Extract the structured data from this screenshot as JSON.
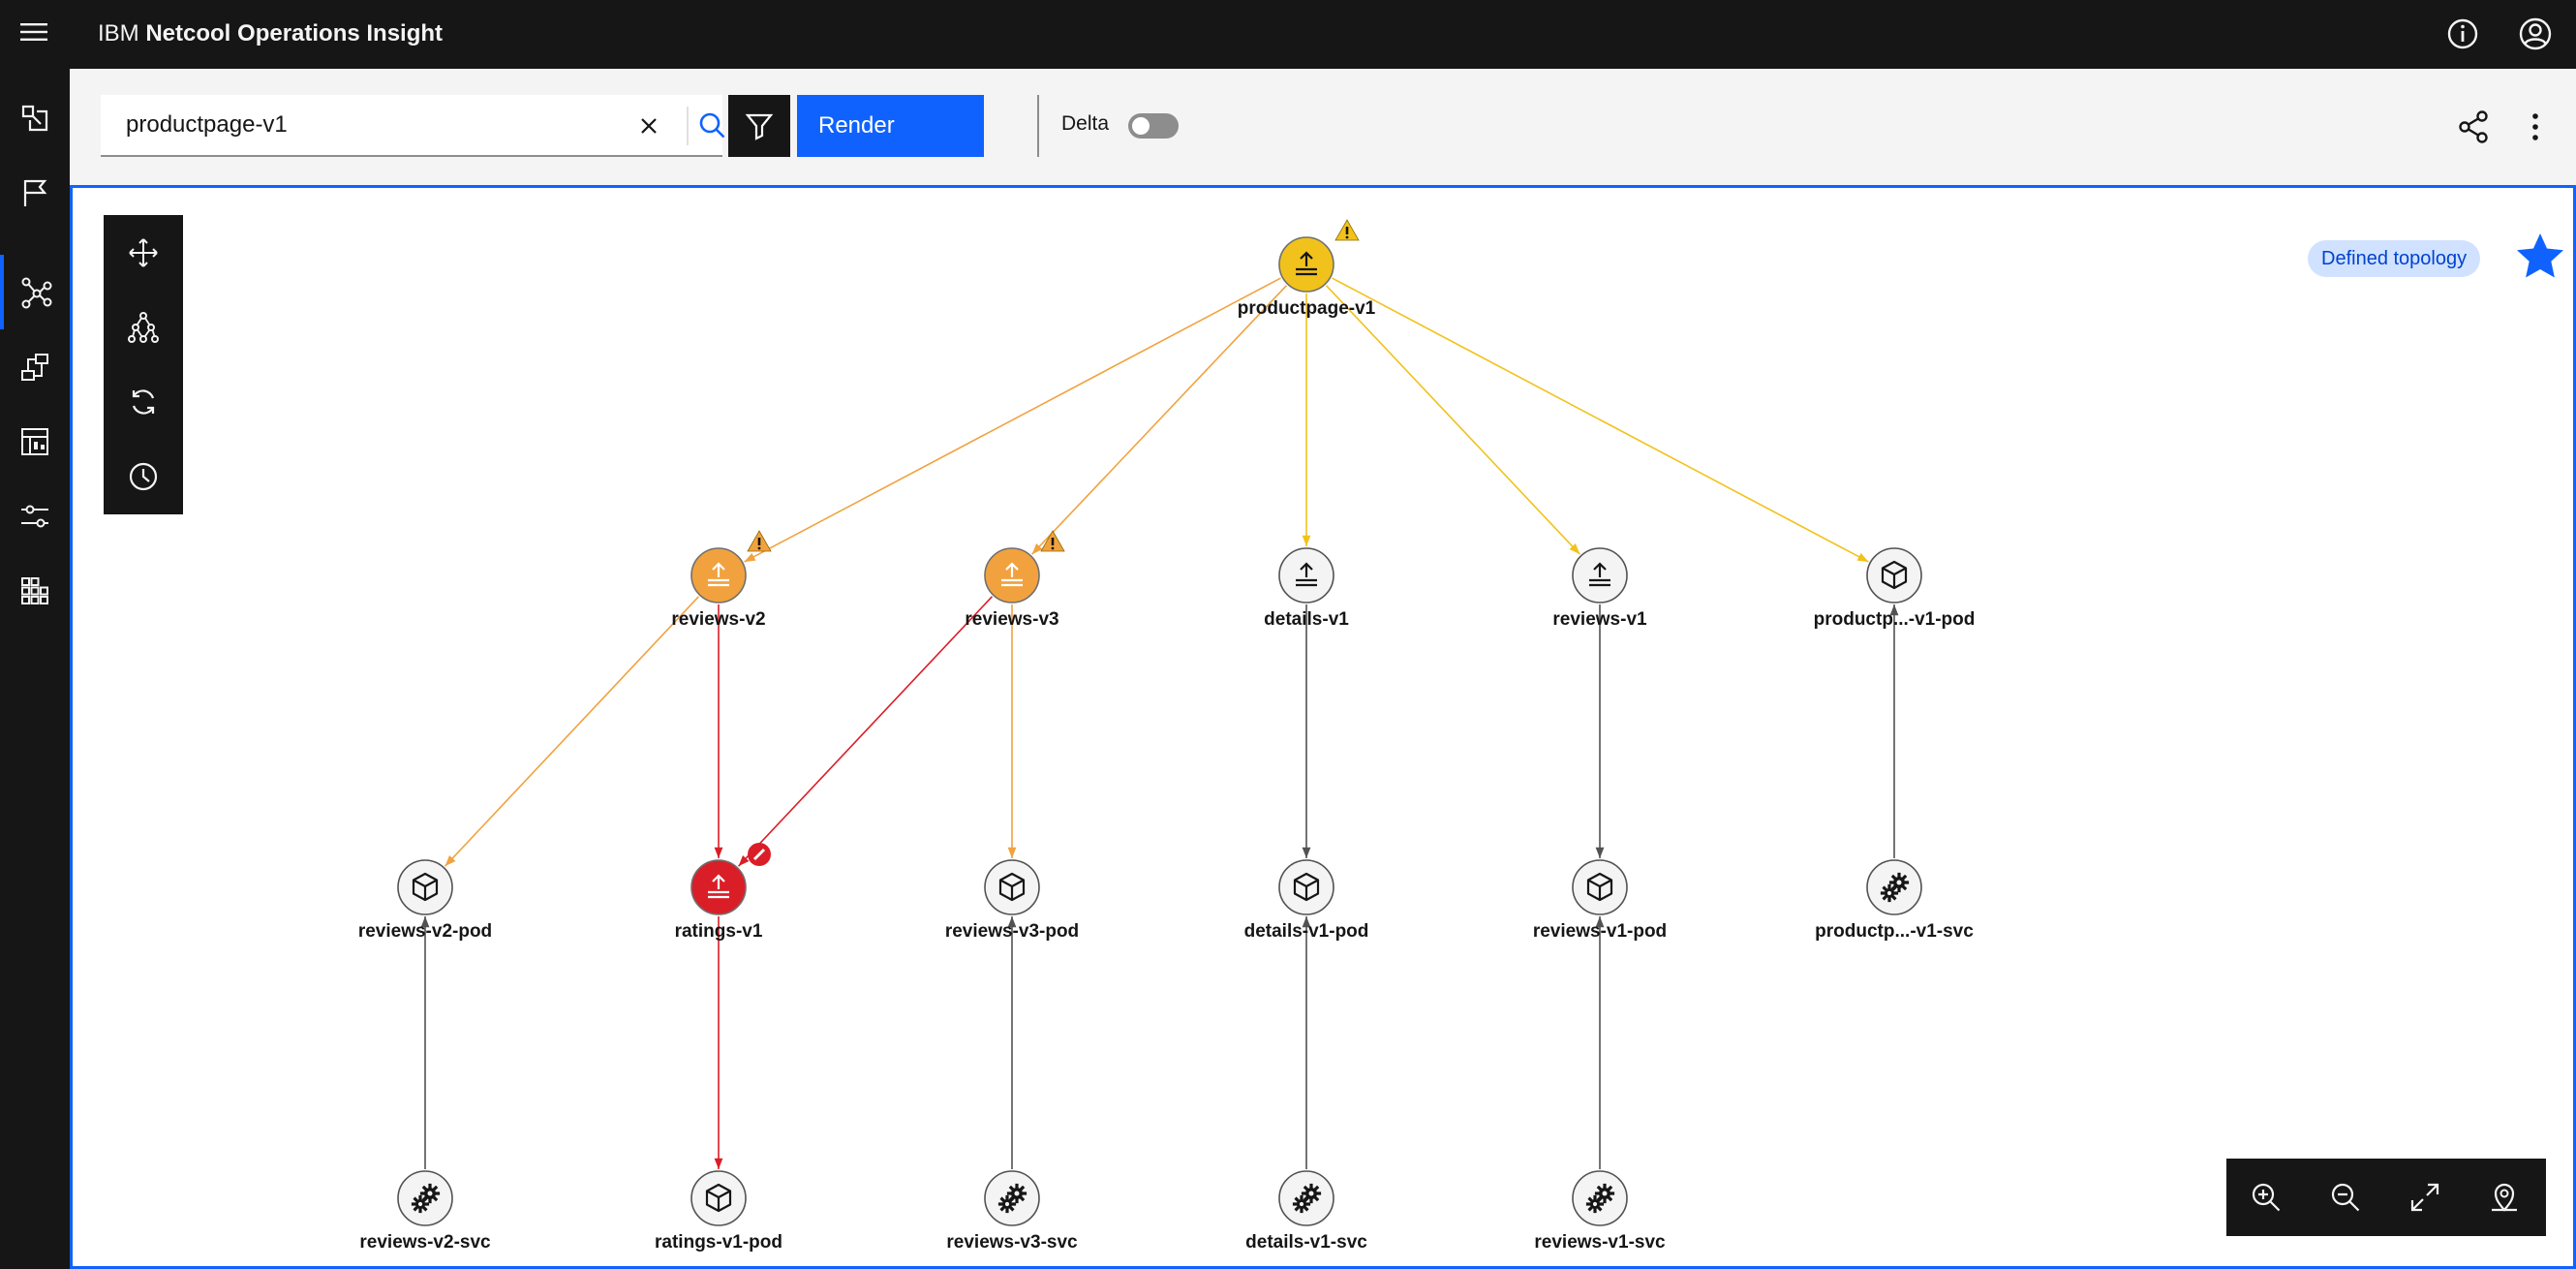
{
  "header": {
    "brand_prefix": "IBM",
    "brand_name": "Netcool Operations Insight",
    "icons": [
      "menu-icon",
      "info-icon",
      "user-icon"
    ]
  },
  "sidenav": {
    "items": [
      {
        "name": "incidents-icon"
      },
      {
        "name": "flag-icon"
      },
      {
        "name": "topology-icon",
        "active": true
      },
      {
        "name": "resources-icon"
      },
      {
        "name": "dashboard-icon"
      },
      {
        "name": "settings-icon"
      },
      {
        "name": "apps-icon"
      }
    ],
    "active_color": "#0f62fe"
  },
  "toolbar": {
    "search": {
      "value": "productpage-v1"
    },
    "render_label": "Render",
    "delta_label": "Delta",
    "delta_on": false
  },
  "canvas": {
    "tag": "Defined topology",
    "accent": "#0f62fe"
  },
  "topology": {
    "nodes": [
      {
        "id": "productpage-v1",
        "label": "productpage-v1",
        "icon": "service-upload-icon",
        "fill": "#f1c21b",
        "status": "warning"
      },
      {
        "id": "reviews-v2",
        "label": "reviews-v2",
        "icon": "service-upload-icon",
        "fill": "#f1a23f",
        "status": "minor"
      },
      {
        "id": "reviews-v3",
        "label": "reviews-v3",
        "icon": "service-upload-icon",
        "fill": "#f1a23f",
        "status": "minor"
      },
      {
        "id": "details-v1",
        "label": "details-v1",
        "icon": "service-upload-icon",
        "fill": "#f4f4f4",
        "status": "none"
      },
      {
        "id": "reviews-v1",
        "label": "reviews-v1",
        "icon": "service-upload-icon",
        "fill": "#f4f4f4",
        "status": "none"
      },
      {
        "id": "productpage-v1-pod",
        "label": "productp...-v1-pod",
        "icon": "cube-icon",
        "fill": "#f4f4f4",
        "status": "none"
      },
      {
        "id": "reviews-v2-pod",
        "label": "reviews-v2-pod",
        "icon": "cube-icon",
        "fill": "#f4f4f4",
        "status": "none"
      },
      {
        "id": "ratings-v1",
        "label": "ratings-v1",
        "icon": "service-upload-icon",
        "fill": "#da1e28",
        "status": "critical"
      },
      {
        "id": "reviews-v3-pod",
        "label": "reviews-v3-pod",
        "icon": "cube-icon",
        "fill": "#f4f4f4",
        "status": "none"
      },
      {
        "id": "details-v1-pod",
        "label": "details-v1-pod",
        "icon": "cube-icon",
        "fill": "#f4f4f4",
        "status": "none"
      },
      {
        "id": "reviews-v1-pod",
        "label": "reviews-v1-pod",
        "icon": "cube-icon",
        "fill": "#f4f4f4",
        "status": "none"
      },
      {
        "id": "productpage-v1-svc",
        "label": "productp...-v1-svc",
        "icon": "gears-icon",
        "fill": "#f4f4f4",
        "status": "none"
      },
      {
        "id": "reviews-v2-svc",
        "label": "reviews-v2-svc",
        "icon": "gears-icon",
        "fill": "#f4f4f4",
        "status": "none"
      },
      {
        "id": "ratings-v1-pod",
        "label": "ratings-v1-pod",
        "icon": "cube-icon",
        "fill": "#f4f4f4",
        "status": "none"
      },
      {
        "id": "reviews-v3-svc",
        "label": "reviews-v3-svc",
        "icon": "gears-icon",
        "fill": "#f4f4f4",
        "status": "none"
      },
      {
        "id": "details-v1-svc",
        "label": "details-v1-svc",
        "icon": "gears-icon",
        "fill": "#f4f4f4",
        "status": "none"
      },
      {
        "id": "reviews-v1-svc",
        "label": "reviews-v1-svc",
        "icon": "gears-icon",
        "fill": "#f4f4f4",
        "status": "none"
      }
    ],
    "edges": [
      {
        "from": "productpage-v1",
        "to": "reviews-v2",
        "color": "#f1a23f"
      },
      {
        "from": "productpage-v1",
        "to": "reviews-v3",
        "color": "#f1a23f"
      },
      {
        "from": "productpage-v1",
        "to": "details-v1",
        "color": "#f1c21b"
      },
      {
        "from": "productpage-v1",
        "to": "reviews-v1",
        "color": "#f1c21b"
      },
      {
        "from": "productpage-v1",
        "to": "productpage-v1-pod",
        "color": "#f1c21b"
      },
      {
        "from": "reviews-v2",
        "to": "reviews-v2-pod",
        "color": "#f1a23f"
      },
      {
        "from": "reviews-v2",
        "to": "ratings-v1",
        "color": "#da1e28"
      },
      {
        "from": "reviews-v3",
        "to": "ratings-v1",
        "color": "#da1e28"
      },
      {
        "from": "reviews-v3",
        "to": "reviews-v3-pod",
        "color": "#f1a23f"
      },
      {
        "from": "details-v1",
        "to": "details-v1-pod",
        "color": "#525252"
      },
      {
        "from": "reviews-v1",
        "to": "reviews-v1-pod",
        "color": "#525252"
      },
      {
        "from": "productpage-v1-svc",
        "to": "productpage-v1-pod",
        "color": "#525252"
      },
      {
        "from": "reviews-v2-svc",
        "to": "reviews-v2-pod",
        "color": "#525252"
      },
      {
        "from": "ratings-v1",
        "to": "ratings-v1-pod",
        "color": "#da1e28"
      },
      {
        "from": "reviews-v3-svc",
        "to": "reviews-v3-pod",
        "color": "#525252"
      },
      {
        "from": "details-v1-svc",
        "to": "details-v1-pod",
        "color": "#525252"
      },
      {
        "from": "reviews-v1-svc",
        "to": "reviews-v1-pod",
        "color": "#525252"
      }
    ],
    "status_colors": {
      "warning": "#f1c21b",
      "minor": "#f1a23f",
      "critical": "#da1e28"
    }
  },
  "tools": [
    "move-icon",
    "hierarchy-icon",
    "refresh-icon",
    "clock-icon"
  ],
  "zoom": [
    "zoom-in-icon",
    "zoom-out-icon",
    "fit-icon",
    "locate-icon"
  ]
}
